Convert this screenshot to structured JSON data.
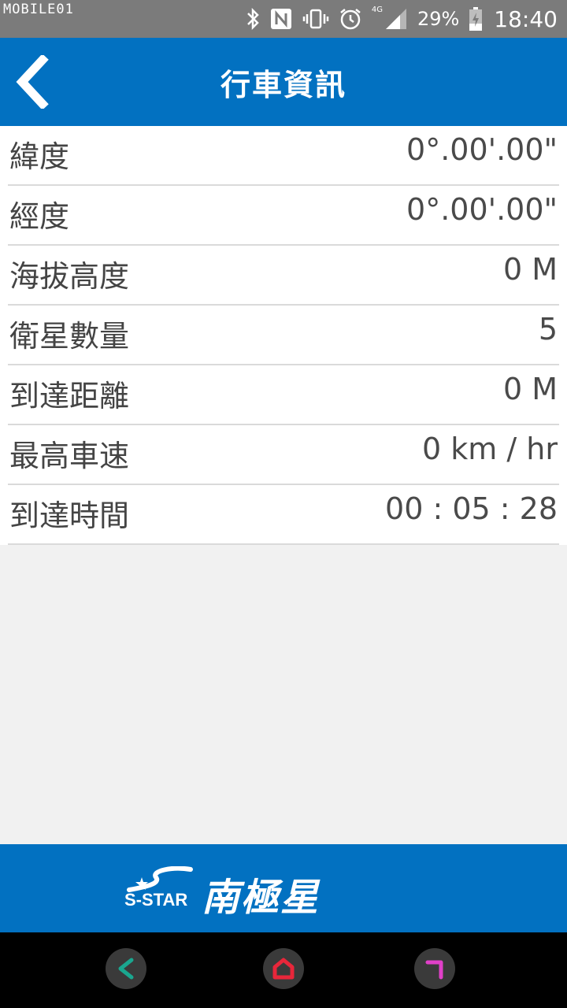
{
  "status_bar": {
    "watermark": "MOBILE01",
    "network": "4G",
    "battery_percent": "29%",
    "time": "18:40"
  },
  "header": {
    "title": "行車資訊"
  },
  "info_rows": [
    {
      "label": "緯度",
      "value": "0°.00'.00\""
    },
    {
      "label": "經度",
      "value": "0°.00'.00\""
    },
    {
      "label": "海拔高度",
      "value": "0 M"
    },
    {
      "label": "衛星數量",
      "value": "5"
    },
    {
      "label": "到達距離",
      "value": "0 M"
    },
    {
      "label": "最高車速",
      "value": "0 km / hr"
    },
    {
      "label": "到達時間",
      "value": "00 : 05 : 28"
    }
  ],
  "footer": {
    "brand_en": "S-STAR",
    "brand_zh": "南極星"
  },
  "colors": {
    "primary": "#0271c1",
    "status_bar": "#7b7b7b",
    "nav_back": "#1aa68f",
    "nav_home": "#e8263a",
    "nav_recent": "#e040c8"
  }
}
